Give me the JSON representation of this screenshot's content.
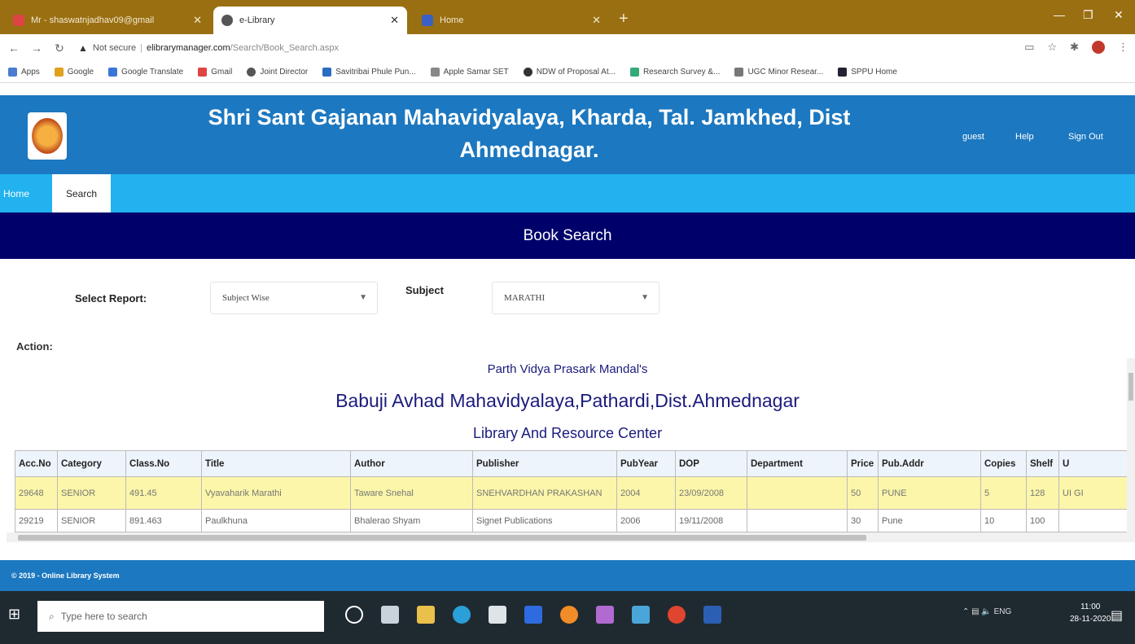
{
  "browser": {
    "tabs": [
      {
        "label": "Mr - shaswatnjadhav09@gmail",
        "icon": "gmail-icon"
      },
      {
        "label": "e-Library",
        "icon": "elibrary-icon"
      },
      {
        "label": "Home",
        "icon": "home-icon"
      }
    ],
    "url_security": "Not secure",
    "url_host": "elibrarymanager.com",
    "url_path": "/Search/Book_Search.aspx",
    "bookmarks": [
      "Apps",
      "Google",
      "Google Translate",
      "Gmail",
      "Joint Director",
      "Savitribai Phule Pun...",
      "Apple Samar SET",
      "NDW of Proposal At...",
      "Research Survey &...",
      "UGC Minor Resear...",
      "SPPU Home"
    ]
  },
  "site": {
    "title_line1": "Shri Sant Gajanan Mahavidyalaya, Kharda, Tal. Jamkhed, Dist",
    "title_line2": "Ahmednagar.",
    "links": {
      "guest": "guest",
      "help": "Help",
      "sign_out": "Sign Out"
    }
  },
  "menu": {
    "home": "Home",
    "search": "Search"
  },
  "banner": "Book Search",
  "filters": {
    "report_label": "Select Report:",
    "report_value": "Subject Wise",
    "subject_label": "Subject",
    "subject_value": "MARATHI"
  },
  "action_label": "Action:",
  "report": {
    "line1": "Parth Vidya Prasark Mandal's",
    "line2": "Babuji Avhad Mahavidyalaya,Pathardi,Dist.Ahmednagar",
    "line3": "Library And Resource Center"
  },
  "table": {
    "columns": [
      "Acc.No",
      "Category",
      "Class.No",
      "Title",
      "Author",
      "Publisher",
      "PubYear",
      "DOP",
      "Department",
      "Price",
      "Pub.Addr",
      "Copies",
      "Shelf",
      "U"
    ],
    "rows": [
      [
        "29648",
        "SENIOR",
        "491.45",
        "Vyavaharik Marathi",
        "Taware Snehal",
        "SNEHVARDHAN PRAKASHAN",
        "2004",
        "23/09/2008",
        "",
        "50",
        "PUNE",
        "5",
        "128",
        "UI GI"
      ],
      [
        "29219",
        "SENIOR",
        "891.463",
        "Paulkhuna",
        "Bhalerao Shyam",
        "Signet Publications",
        "2006",
        "19/11/2008",
        "",
        "30",
        "Pune",
        "10",
        "100",
        ""
      ]
    ]
  },
  "footer": "© 2019 - Online Library System",
  "taskbar": {
    "search_placeholder": "Type here to search",
    "tray": "ENG",
    "time": "11:00",
    "date": "28-11-2020"
  },
  "colors": {
    "header": "#1c78c0",
    "menu": "#21b2ef",
    "banner": "#00006b",
    "highlight_row": "#fbf6a9",
    "titlebar": "#9a6f12"
  }
}
